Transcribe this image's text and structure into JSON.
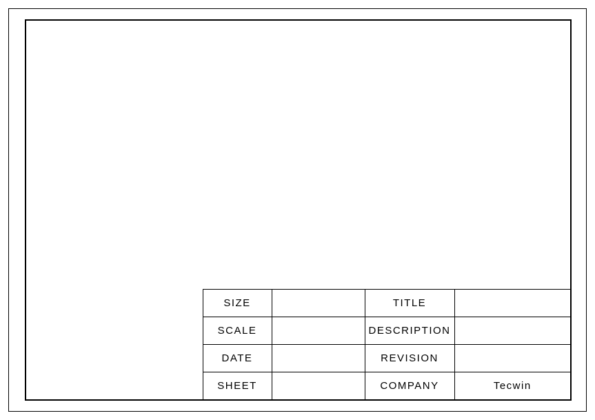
{
  "title_block": {
    "rows": [
      {
        "label_a": "SIZE",
        "value_a": "",
        "label_b": "TITLE",
        "value_b": ""
      },
      {
        "label_a": "SCALE",
        "value_a": "",
        "label_b": "DESCRIPTION",
        "value_b": ""
      },
      {
        "label_a": "DATE",
        "value_a": "",
        "label_b": "REVISION",
        "value_b": ""
      },
      {
        "label_a": "SHEET",
        "value_a": "",
        "label_b": "COMPANY",
        "value_b": "Tecwin"
      }
    ]
  }
}
